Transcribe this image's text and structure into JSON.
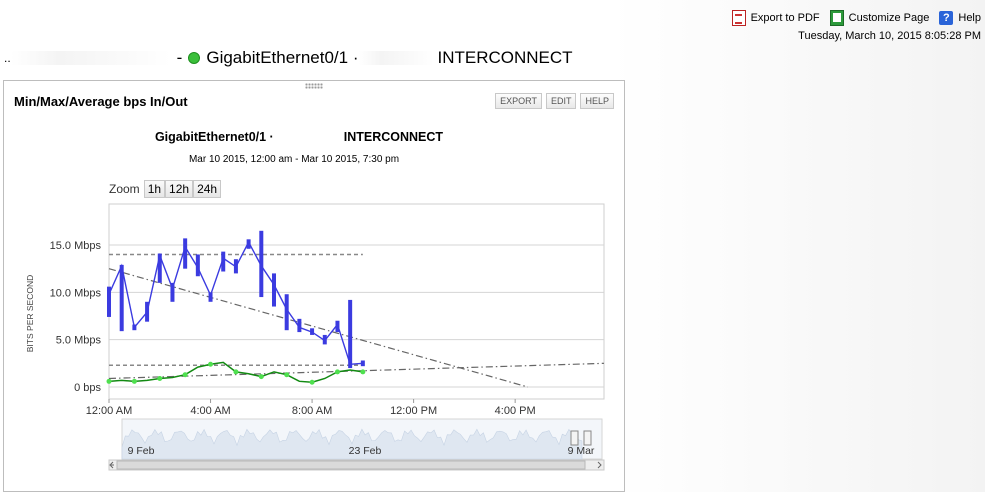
{
  "toplinks": {
    "export_pdf": "Export to PDF",
    "customize": "Customize Page",
    "help": "Help"
  },
  "datetime": "Tuesday, March 10, 2015 8:05:28 PM",
  "breadcrumb": {
    "prefix": "..",
    "separator": "-",
    "interface": "GigabitEthernet0/1 ·",
    "suffix": "INTERCONNECT"
  },
  "panel": {
    "title": "Min/Max/Average bps In/Out",
    "buttons": {
      "export": "EXPORT",
      "edit": "EDIT",
      "help": "HELP"
    }
  },
  "chart_data": {
    "type": "line",
    "title_left": "GigabitEthernet0/1 ·",
    "title_right": "INTERCONNECT",
    "subtitle": "Mar 10 2015, 12:00 am - Mar 10 2015, 7:30 pm",
    "ylabel": "BITS PER SECOND",
    "yticks": [
      "0 bps",
      "5.0 Mbps",
      "10.0 Mbps",
      "15.0 Mbps"
    ],
    "ylim": [
      0,
      18.5
    ],
    "xticks": [
      "12:00 AM",
      "4:00 AM",
      "8:00 AM",
      "12:00 PM",
      "4:00 PM"
    ],
    "xlim_hours": [
      0,
      19.5
    ],
    "zoom": {
      "label": "Zoom",
      "options": [
        "1h",
        "12h",
        "24h"
      ]
    },
    "series": [
      {
        "color": "#3b3be0",
        "x": [
          0,
          0.5,
          1,
          1.5,
          2,
          2.5,
          3,
          3.5,
          4,
          4.5,
          5,
          5.5,
          6,
          6.5,
          7,
          7.5,
          8,
          8.5,
          9,
          9.5,
          10
        ],
        "avg": [
          9.8,
          12.8,
          6.3,
          7.9,
          13.9,
          10.4,
          14.8,
          12.6,
          9.7,
          13.6,
          12.7,
          15.3,
          12.8,
          10.8,
          8.2,
          6.3,
          5.8,
          4.9,
          6.6,
          2.4,
          2.5
        ],
        "min": [
          7.4,
          5.9,
          6.0,
          6.9,
          11.0,
          9.0,
          12.5,
          11.7,
          9.0,
          12.2,
          12.0,
          14.6,
          9.5,
          8.5,
          6.0,
          5.8,
          5.5,
          4.5,
          5.8,
          2.0,
          2.2
        ],
        "max": [
          10.6,
          12.9,
          6.6,
          9.0,
          14.1,
          11.0,
          15.7,
          14.0,
          10.0,
          14.3,
          13.5,
          15.6,
          16.5,
          12.0,
          9.8,
          7.2,
          6.2,
          5.5,
          7.0,
          9.2,
          2.8
        ]
      },
      {
        "color": "#128a12",
        "marker_color": "#4fe04f",
        "x": [
          0,
          0.5,
          1,
          1.5,
          2,
          2.5,
          3,
          3.5,
          4,
          4.5,
          5,
          5.5,
          6,
          6.5,
          7,
          7.5,
          8,
          8.5,
          9,
          9.5,
          10
        ],
        "avg": [
          0.6,
          0.7,
          0.6,
          0.7,
          0.9,
          1.0,
          1.3,
          2.1,
          2.4,
          2.6,
          1.6,
          1.4,
          1.1,
          1.6,
          1.3,
          0.6,
          0.5,
          0.9,
          1.6,
          1.8,
          1.6
        ]
      }
    ],
    "reference_lines": [
      {
        "kind": "max",
        "value": 14.0,
        "x_end": 10
      },
      {
        "kind": "min",
        "value": 2.3,
        "x_end": 10
      }
    ],
    "trend_lines": [
      {
        "from": [
          0,
          12.5
        ],
        "to": [
          16.5,
          0
        ]
      },
      {
        "from": [
          0,
          0.9
        ],
        "to": [
          19.5,
          2.5
        ]
      }
    ],
    "navigator": {
      "labels": [
        "9 Feb",
        "23 Feb",
        "9 Mar"
      ]
    }
  }
}
